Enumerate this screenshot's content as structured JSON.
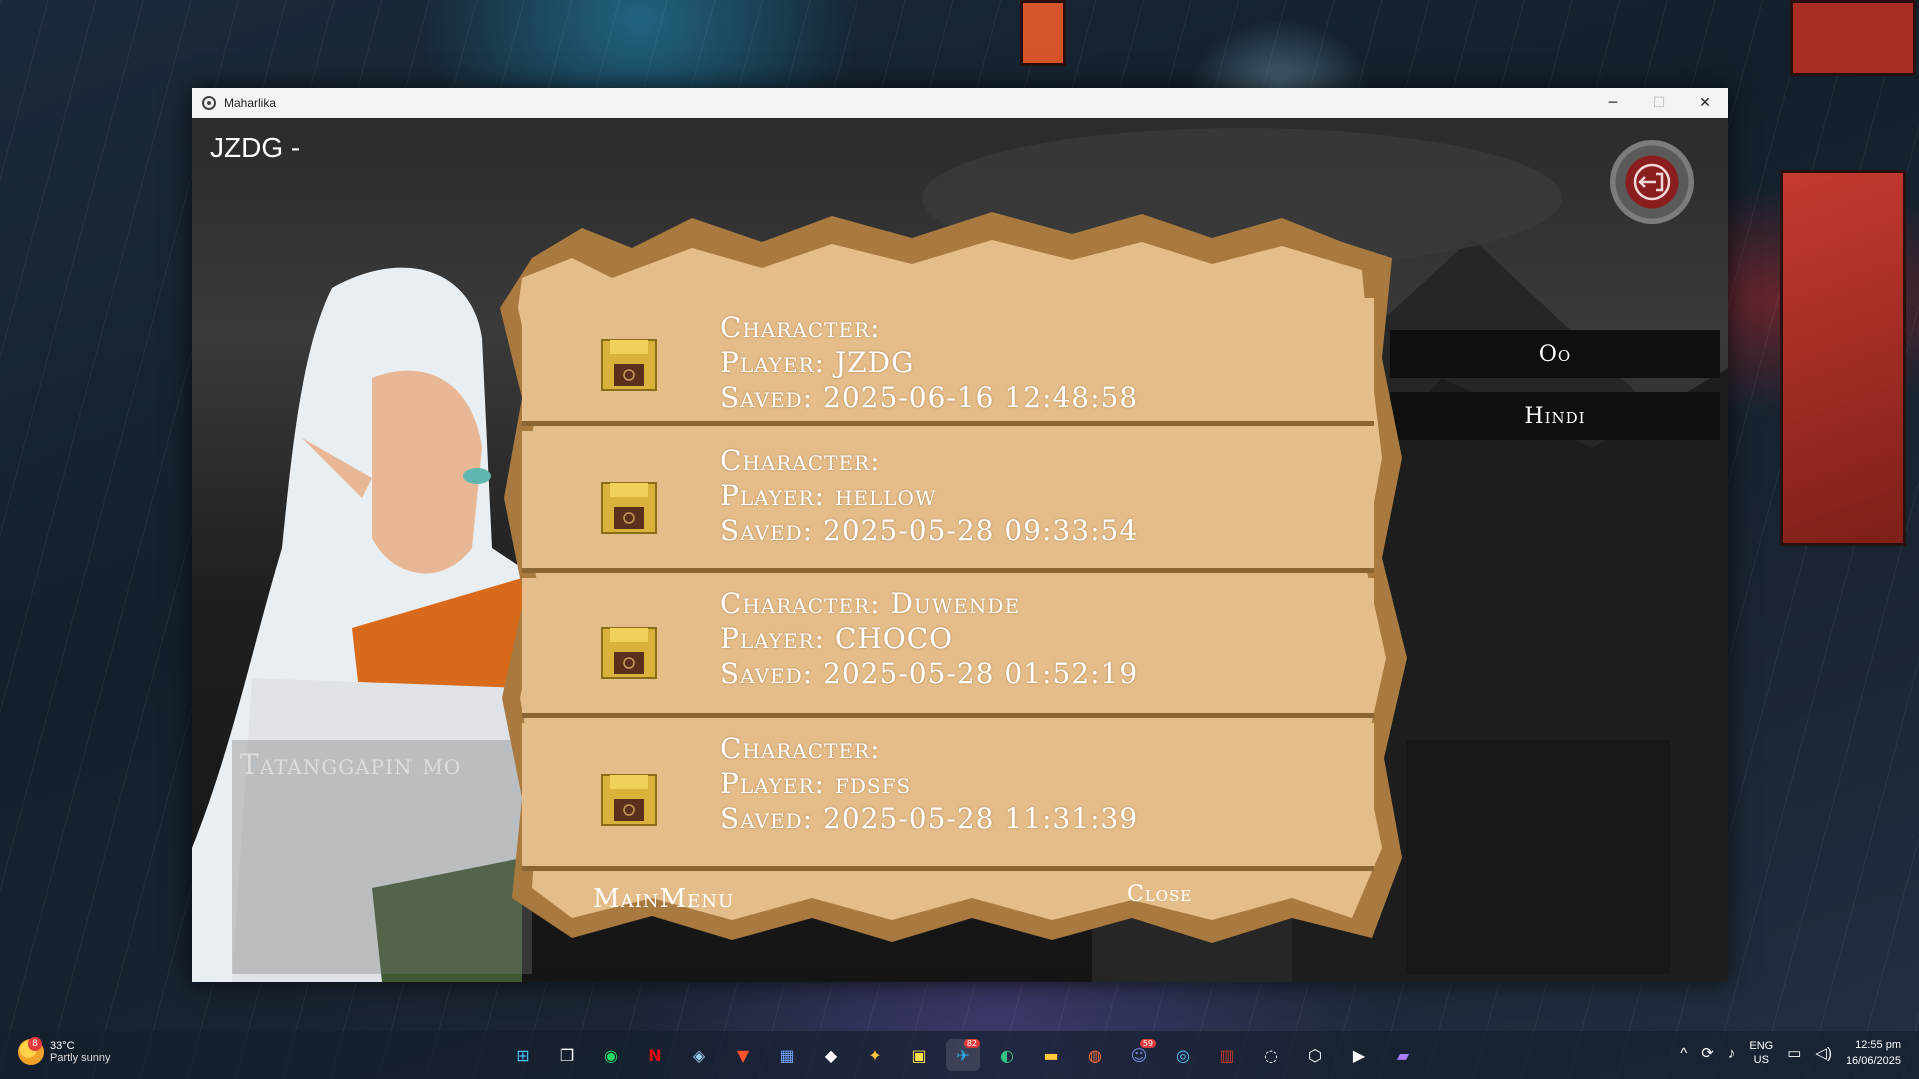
{
  "window": {
    "title": "Maharlika",
    "minimize_glyph": "─",
    "maximize_glyph": "☐",
    "close_glyph": "✕"
  },
  "game": {
    "player_heading": "JZDG -",
    "dialog_text": "Tatanggapin mo",
    "choices": [
      "Oo",
      "Hindi"
    ],
    "exit_icon": "exit-door-icon"
  },
  "save_slots": [
    {
      "character": "Character:",
      "player": "Player: JZDG",
      "saved": "Saved: 2025-06-16 12:48:58"
    },
    {
      "character": "Character:",
      "player": "Player: hellow",
      "saved": "Saved: 2025-05-28 09:33:54"
    },
    {
      "character": "Character: Duwende",
      "player": "Player: CHOCO",
      "saved": "Saved: 2025-05-28 01:52:19"
    },
    {
      "character": "Character:",
      "player": "Player: fdsfs",
      "saved": "Saved: 2025-05-28 11:31:39"
    }
  ],
  "parchment_footer": {
    "main_menu": "MainMenu",
    "close": "Close"
  },
  "colors": {
    "parchment": "#e5bd8a",
    "parchment_edge": "#a87a40",
    "slot_divider": "#8a6433",
    "choice_bg": "#0f0f0f"
  },
  "taskbar": {
    "weather_badge": "8",
    "temperature": "33°C",
    "condition": "Partly sunny",
    "icons": [
      {
        "name": "start-icon",
        "glyph": "⊞"
      },
      {
        "name": "task-view-icon",
        "glyph": "❐"
      },
      {
        "name": "spotify-icon",
        "glyph": "◉"
      },
      {
        "name": "netflix-icon",
        "glyph": "N"
      },
      {
        "name": "steam-icon",
        "glyph": "◈"
      },
      {
        "name": "brave-icon",
        "glyph": "▼"
      },
      {
        "name": "app-icon-1",
        "glyph": "▦"
      },
      {
        "name": "epic-icon",
        "glyph": "◆"
      },
      {
        "name": "app-icon-2",
        "glyph": "✦"
      },
      {
        "name": "sticky-notes-icon",
        "glyph": "▣"
      },
      {
        "name": "telegram-icon",
        "glyph": "✈"
      },
      {
        "name": "edge-icon",
        "glyph": "◐"
      },
      {
        "name": "file-explorer-icon",
        "glyph": "▬"
      },
      {
        "name": "firefox-icon",
        "glyph": "◍"
      },
      {
        "name": "discord-icon",
        "glyph": "☺"
      },
      {
        "name": "browser-icon",
        "glyph": "◎"
      },
      {
        "name": "winrar-icon",
        "glyph": "▥"
      },
      {
        "name": "obs-icon",
        "glyph": "◌"
      },
      {
        "name": "unity-icon",
        "glyph": "⬡"
      },
      {
        "name": "media-player-icon",
        "glyph": "▶"
      },
      {
        "name": "clipchamp-icon",
        "glyph": "▰"
      }
    ],
    "telegram_badge": "82",
    "discord_badge": "59",
    "tray_chevron": "^",
    "lang_line1": "ENG",
    "lang_line2": "US",
    "time": "12:55 pm",
    "date": "16/06/2025"
  }
}
